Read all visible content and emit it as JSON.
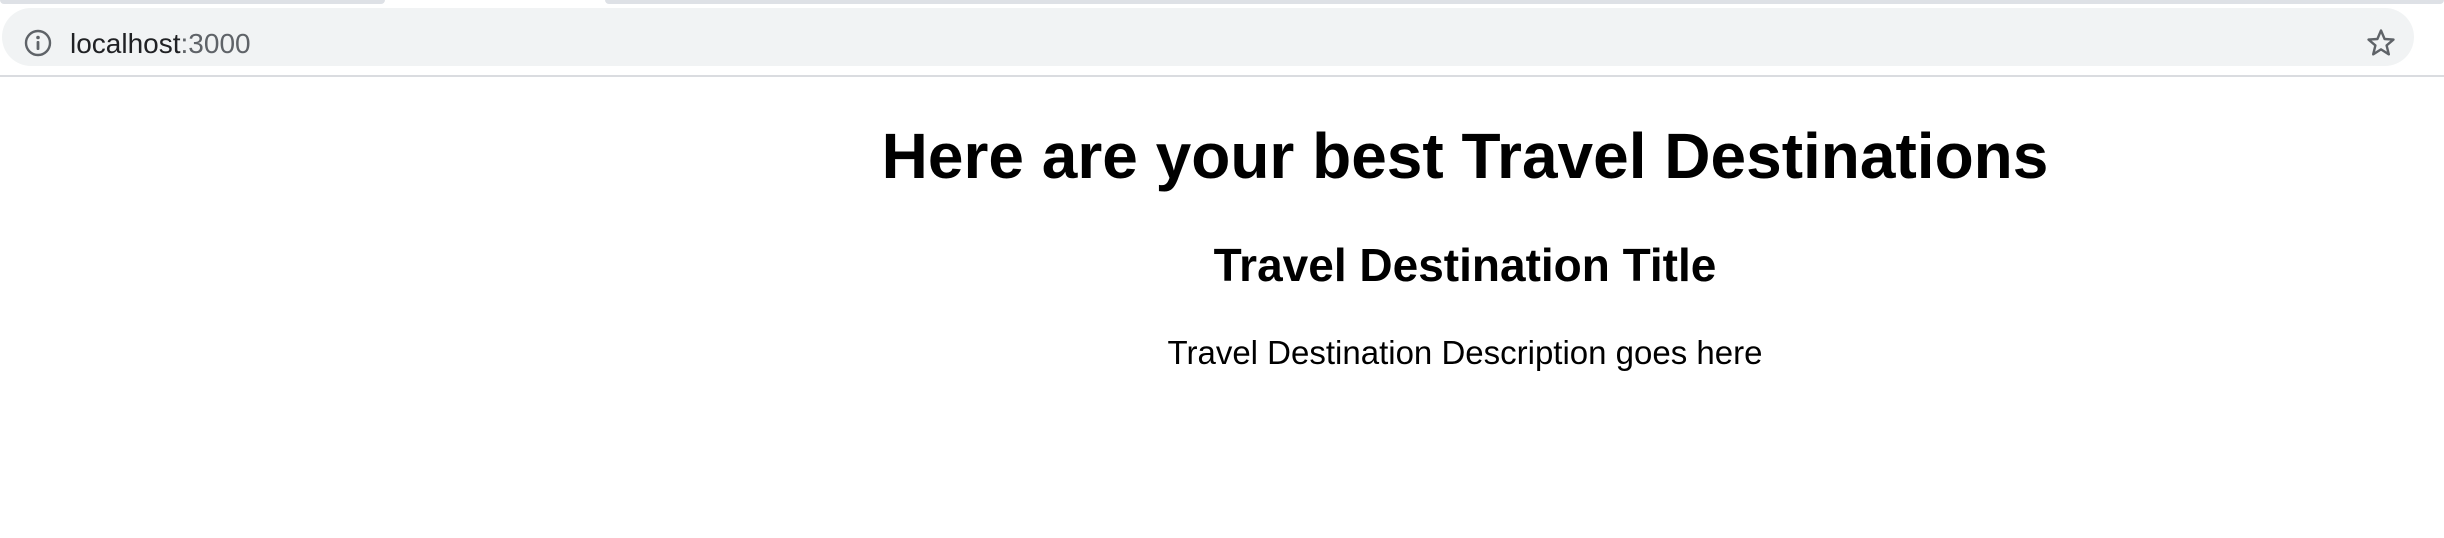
{
  "browser": {
    "url_host": "localhost",
    "url_port": ":3000",
    "info_icon": "info-icon",
    "bookmark_icon": "star-icon"
  },
  "page": {
    "heading": "Here are your best Travel Destinations",
    "destination": {
      "title": "Travel Destination Title",
      "description": "Travel Destination Description goes here"
    }
  }
}
